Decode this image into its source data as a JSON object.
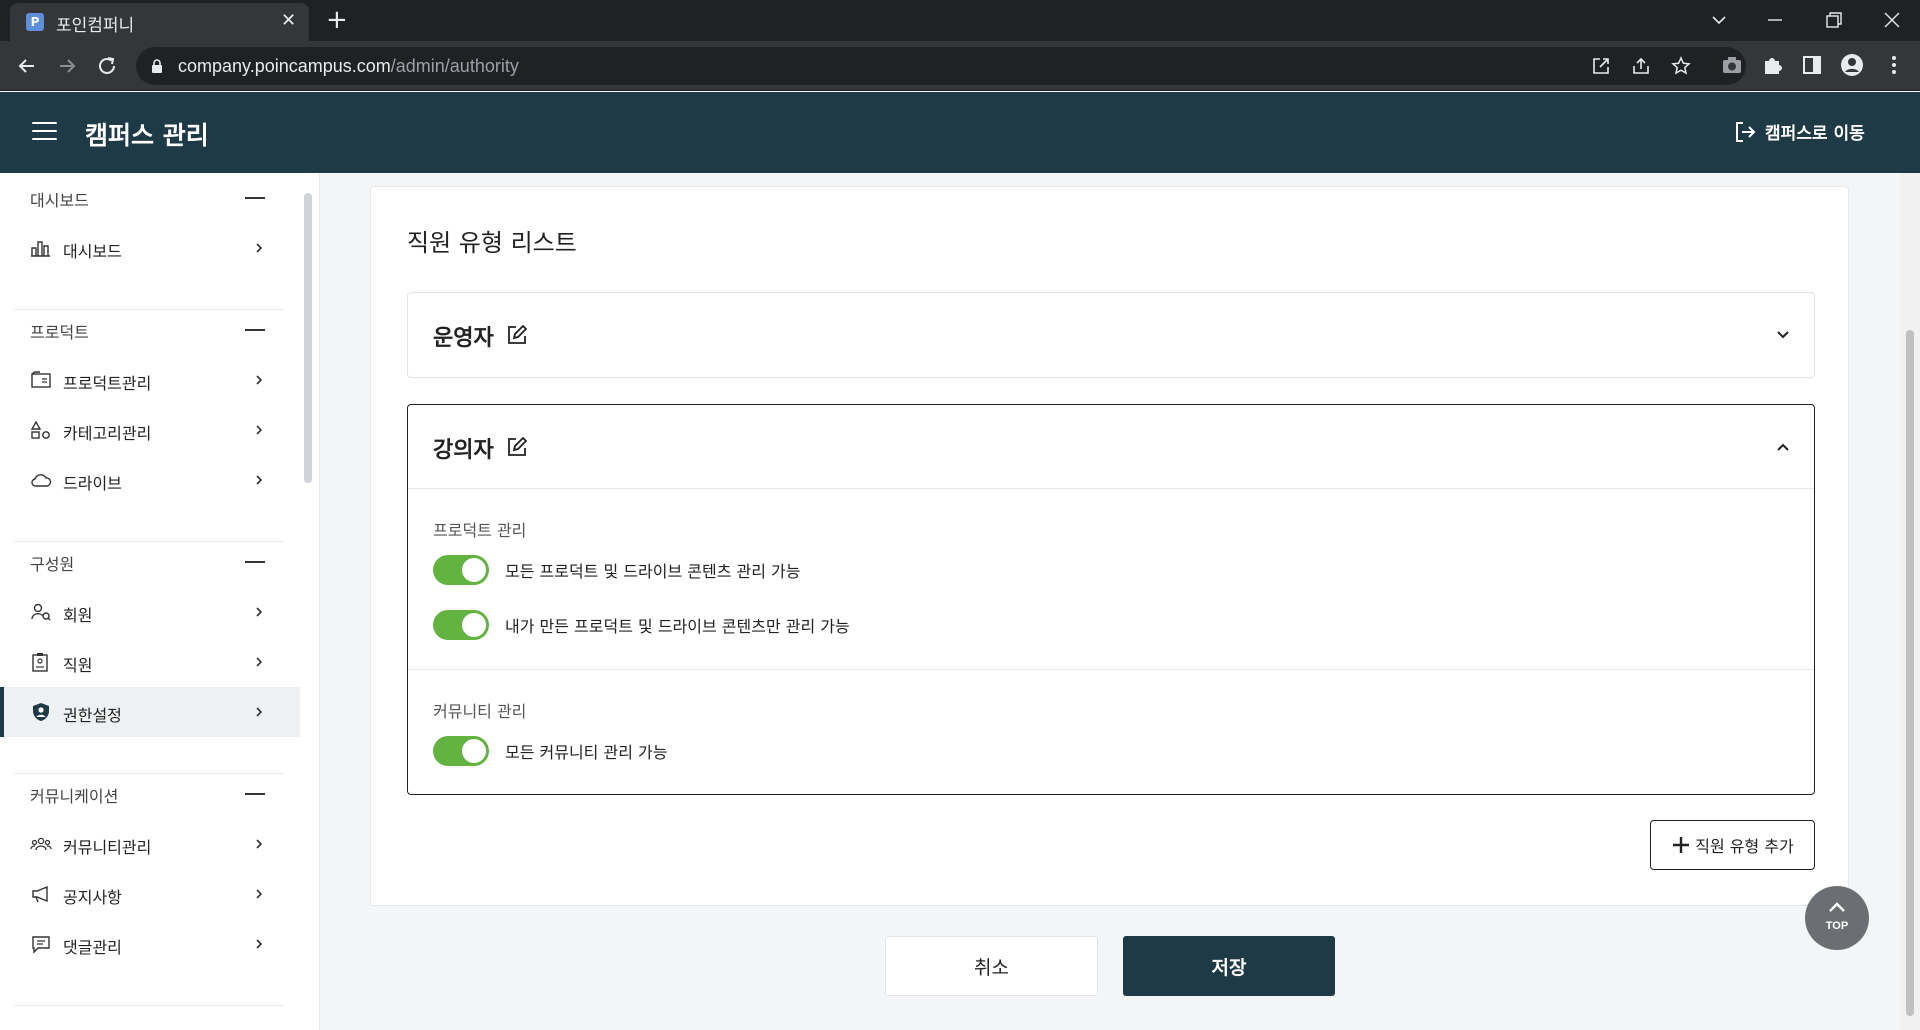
{
  "browser": {
    "tab_title": "포인컴퍼니",
    "favicon_letter": "P",
    "url_host": "company.poincampus.com",
    "url_path": "/admin/authority"
  },
  "header": {
    "title": "캠퍼스 관리",
    "goto_label": "캠퍼스로 이동"
  },
  "sidebar": {
    "sections": [
      {
        "label": "대시보드",
        "items": [
          {
            "label": "대시보드",
            "icon": "bar-chart-icon"
          }
        ]
      },
      {
        "label": "프로덕트",
        "items": [
          {
            "label": "프로덕트관리",
            "icon": "product-icon"
          },
          {
            "label": "카테고리관리",
            "icon": "category-icon"
          },
          {
            "label": "드라이브",
            "icon": "cloud-icon"
          }
        ]
      },
      {
        "label": "구성원",
        "items": [
          {
            "label": "회원",
            "icon": "member-icon"
          },
          {
            "label": "직원",
            "icon": "staff-icon"
          },
          {
            "label": "권한설정",
            "icon": "shield-user-icon",
            "active": true
          }
        ]
      },
      {
        "label": "커뮤니케이션",
        "items": [
          {
            "label": "커뮤니티관리",
            "icon": "community-icon"
          },
          {
            "label": "공지사항",
            "icon": "megaphone-icon"
          },
          {
            "label": "댓글관리",
            "icon": "comment-icon"
          }
        ]
      }
    ]
  },
  "main": {
    "title": "직원 유형 리스트",
    "roles": [
      {
        "name": "운영자",
        "expanded": false
      },
      {
        "name": "강의자",
        "expanded": true,
        "groups": [
          {
            "label": "프로덕트 관리",
            "perms": [
              {
                "label": "모든 프로덕트 및 드라이브 콘텐츠 관리 가능",
                "enabled": true
              },
              {
                "label": "내가 만든 프로덕트 및 드라이브 콘텐츠만 관리 가능",
                "enabled": true
              }
            ]
          },
          {
            "label": "커뮤니티 관리",
            "perms": [
              {
                "label": "모든 커뮤니티 관리 가능",
                "enabled": true
              }
            ]
          }
        ]
      }
    ],
    "add_role_label": "직원 유형 추가",
    "cancel_label": "취소",
    "save_label": "저장",
    "top_label": "TOP"
  },
  "colors": {
    "brand": "#1e3a47",
    "toggle_on": "#62b33f"
  }
}
